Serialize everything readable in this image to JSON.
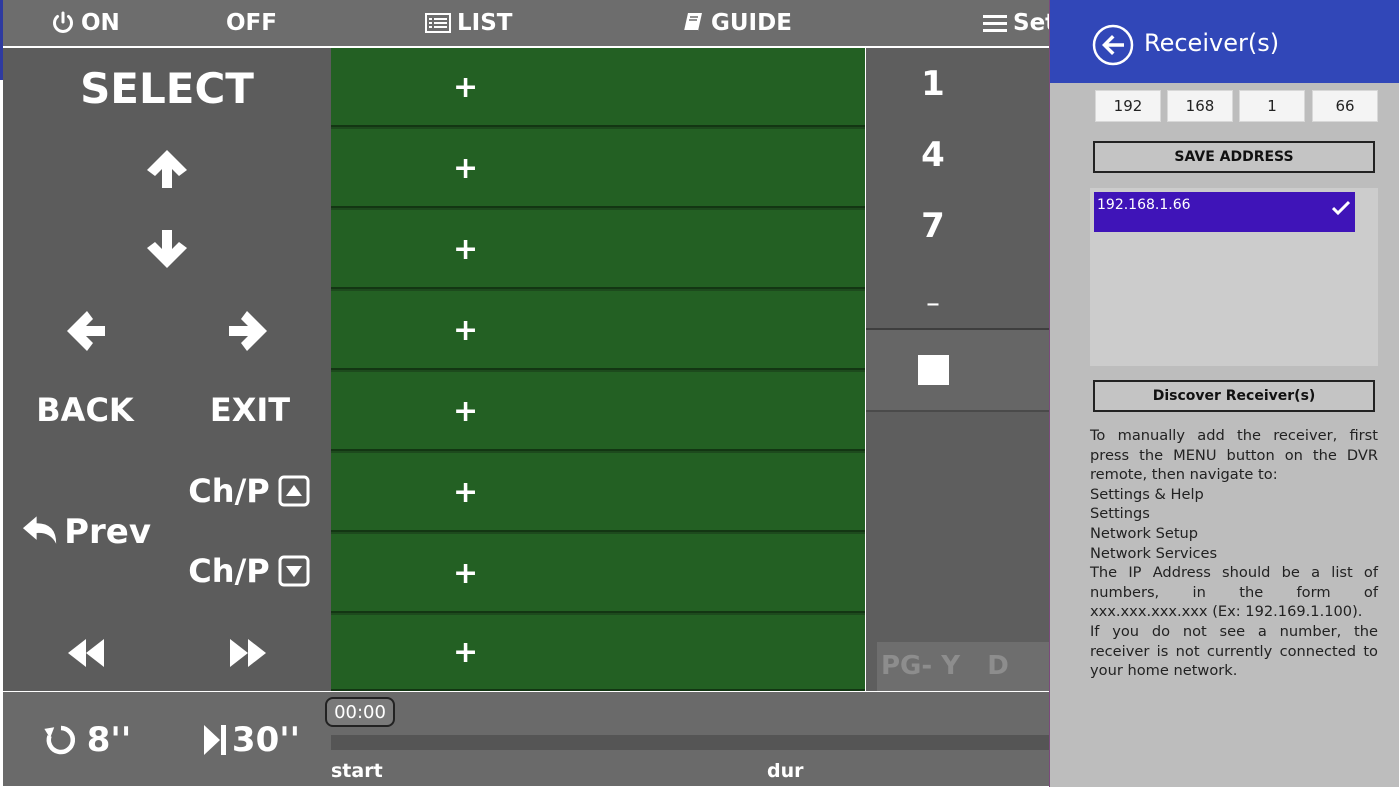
{
  "topbar": {
    "on_label": "ON",
    "off_label": "OFF",
    "list_label": "LIST",
    "guide_label": "GUIDE",
    "settings_label": "Set"
  },
  "remote": {
    "select_label": "SELECT",
    "back_label": "BACK",
    "exit_label": "EXIT",
    "prev_label": "Prev",
    "ch_up_label": "Ch/P",
    "ch_down_label": "Ch/P"
  },
  "list_rows": [
    "+",
    "+",
    "+",
    "+",
    "+",
    "+",
    "+",
    "+"
  ],
  "numpad": {
    "keys": [
      "1",
      "4",
      "7",
      "_"
    ],
    "rating_text": "PG- Y   D"
  },
  "bottombar": {
    "replay_label": "8''",
    "skip_label": "30''",
    "time": "00:00",
    "start_label": "start",
    "dur_label": "dur"
  },
  "flyout": {
    "title": "Receiver(s)",
    "ip_parts": [
      "192",
      "168",
      "1",
      "66"
    ],
    "save_label": "SAVE ADDRESS",
    "receivers": [
      "192.168.1.66"
    ],
    "discover_label": "Discover Receiver(s)",
    "help_lines": [
      "To manually add the receiver, first press the MENU button on the DVR remote, then navigate to:",
      "Settings & Help",
      "Settings",
      "Network Setup",
      "Network Services",
      "The IP Address should be a list of numbers, in the form of xxx.xxx.xxx.xxx (Ex: 192.169.1.100).",
      "If you do not see a number, the receiver is not currently connected to your home network."
    ]
  },
  "colors": {
    "header_blue": "#3147b8",
    "selected_purple": "#3f14b8",
    "row_green": "#236023"
  }
}
